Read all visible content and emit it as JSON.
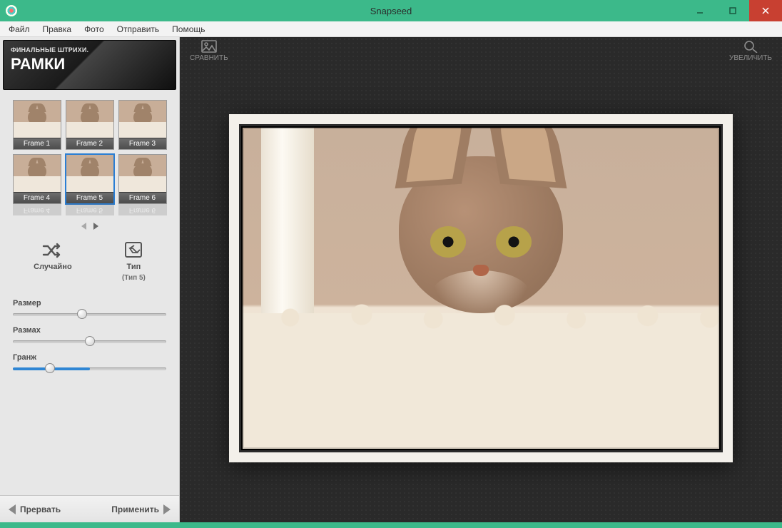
{
  "window": {
    "title": "Snapseed"
  },
  "menu": {
    "items": [
      "Файл",
      "Правка",
      "Фото",
      "Отправить",
      "Помощь"
    ]
  },
  "sidebar": {
    "subtitle": "ФИНАЛЬНЫЕ ШТРИХИ.",
    "title": "РАМКИ",
    "frames": [
      "Frame 1",
      "Frame 2",
      "Frame 3",
      "Frame 4",
      "Frame 5",
      "Frame 6"
    ],
    "selected_frame_index": 4,
    "tools": {
      "random": "Случайно",
      "type": "Тип",
      "type_sub": "(Тип 5)"
    },
    "sliders": {
      "size": {
        "label": "Размер",
        "pct": 45
      },
      "spread": {
        "label": "Размах",
        "pct": 50
      },
      "grunge": {
        "label": "Гранж",
        "pct": 24,
        "fill_pct": 50
      }
    }
  },
  "canvas": {
    "compare": "СРАВНИТЬ",
    "zoom": "УВЕЛИЧИТЬ"
  },
  "footer": {
    "cancel": "Прервать",
    "apply": "Применить"
  }
}
